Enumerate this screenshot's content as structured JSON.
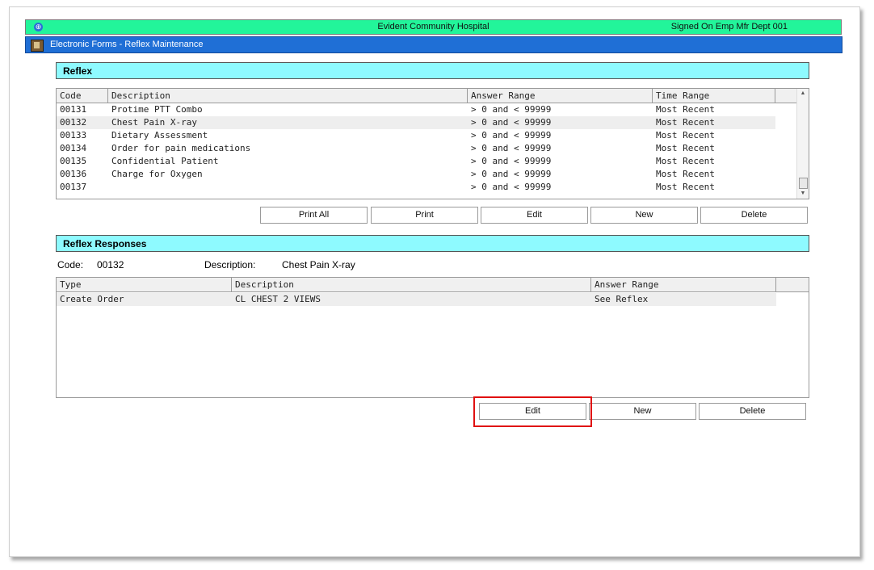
{
  "app": {
    "hospital_name": "Evident Community Hospital",
    "signed_on": "Signed On Emp Mfr   Dept 001",
    "breadcrumb": "Electronic Forms - Reflex Maintenance"
  },
  "reflex": {
    "section_title": "Reflex",
    "columns": [
      "Code",
      "Description",
      "Answer Range",
      "Time Range"
    ],
    "rows": [
      {
        "code": "00131",
        "description": "Protime PTT Combo",
        "answer_range": "> 0 and < 99999",
        "time_range": "Most Recent"
      },
      {
        "code": "00132",
        "description": "Chest Pain X-ray",
        "answer_range": "> 0 and < 99999",
        "time_range": "Most Recent"
      },
      {
        "code": "00133",
        "description": "Dietary Assessment",
        "answer_range": "> 0 and < 99999",
        "time_range": "Most Recent"
      },
      {
        "code": "00134",
        "description": "Order for pain medications",
        "answer_range": "> 0 and < 99999",
        "time_range": "Most Recent"
      },
      {
        "code": "00135",
        "description": "Confidential Patient",
        "answer_range": "> 0 and < 99999",
        "time_range": "Most Recent"
      },
      {
        "code": "00136",
        "description": "Charge for Oxygen",
        "answer_range": "> 0 and < 99999",
        "time_range": "Most Recent"
      },
      {
        "code": "00137",
        "description": "",
        "answer_range": "> 0 and < 99999",
        "time_range": "Most Recent"
      }
    ],
    "buttons": {
      "print_all": "Print All",
      "print": "Print",
      "edit": "Edit",
      "new": "New",
      "delete": "Delete"
    }
  },
  "responses": {
    "section_title": "Reflex Responses",
    "code_label": "Code:",
    "code_value": "00132",
    "description_label": "Description:",
    "description_value": "Chest Pain X-ray",
    "columns": [
      "Type",
      "Description",
      "Answer Range"
    ],
    "rows": [
      {
        "type": "Create Order",
        "description": "CL CHEST 2 VIEWS",
        "answer_range": "See Reflex"
      }
    ],
    "buttons": {
      "edit": "Edit",
      "new": "New",
      "delete": "Delete"
    }
  }
}
